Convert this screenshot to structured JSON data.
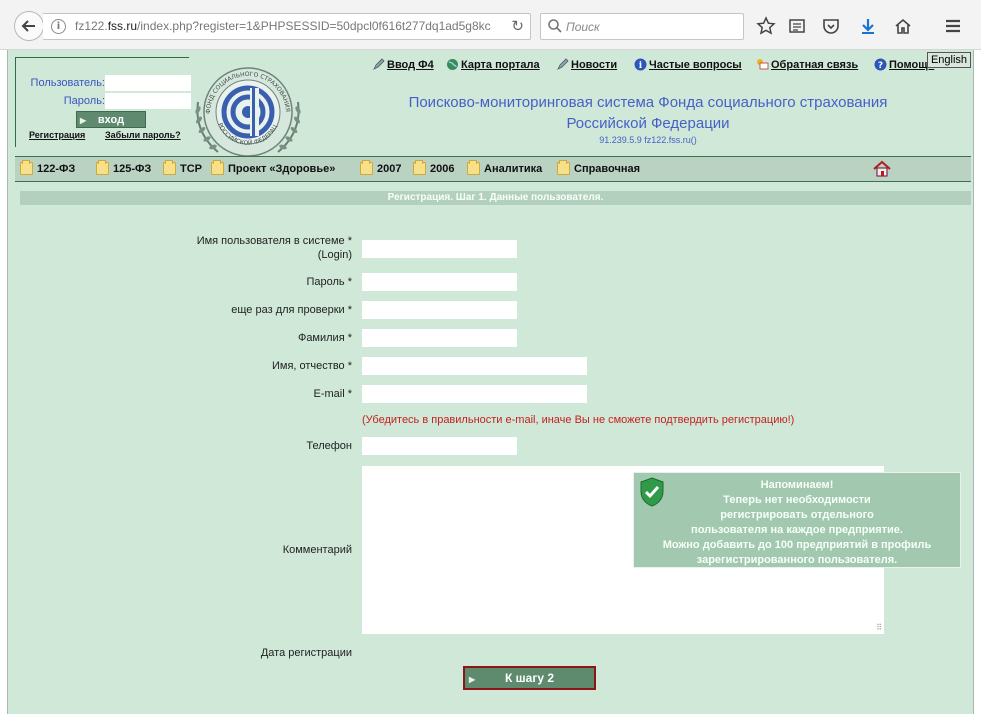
{
  "browser": {
    "url_prefix": "fz122.",
    "url_domain": "fss.ru",
    "url_rest": "/index.php?register=1&PHPSESSID=50dpcl0f616t277dq1ad5g8kc",
    "search_placeholder": "Поиск",
    "info_glyph": "i",
    "reload_glyph": "↻"
  },
  "login": {
    "user_label": "Пользователь:",
    "password_label": "Пароль:",
    "login_button": "вход",
    "register_link": "Регистрация",
    "forgot_link": "Забыли пароль?"
  },
  "logo": {
    "ring_text_top": "ФОНД СОЦИАЛЬНОГО СТРАХОВАНИЯ",
    "ring_text_bottom": "РОССИЙСКОЙ ФЕДЕРАЦИИ"
  },
  "top_links": [
    {
      "label": "Ввод Ф4",
      "icon": "pen-icon"
    },
    {
      "label": "Карта портала",
      "icon": "globe-icon"
    },
    {
      "label": "Новости",
      "icon": "pen-icon"
    },
    {
      "label": "Частые вопросы",
      "icon": "info-icon"
    },
    {
      "label": "Обратная связь",
      "icon": "mail-icon"
    },
    {
      "label": "Помощь",
      "icon": "help-icon"
    }
  ],
  "english": "English",
  "header": {
    "title_line1": "Поисково-мониторинговая система Фонда социального страхования",
    "title_line2": "Российской Федерации",
    "subtitle": "91.239.5.9  fz122.fss.ru()"
  },
  "menu": [
    {
      "label": "122-ФЗ"
    },
    {
      "label": "125-ФЗ"
    },
    {
      "label": "ТСР"
    },
    {
      "label": "Проект «Здоровье»"
    },
    {
      "label": "2007"
    },
    {
      "label": "2006"
    },
    {
      "label": "Аналитика"
    },
    {
      "label": "Справочная"
    }
  ],
  "section_title": "Регистрация. Шаг 1. Данные пользователя.",
  "form": {
    "login_label": "Имя пользователя в системе *",
    "login_label2": "(Login)",
    "password_label": "Пароль *",
    "password_repeat_label": "еще раз для проверки *",
    "surname_label": "Фамилия *",
    "name_label": "Имя, отчество *",
    "email_label": "E-mail *",
    "email_warning": "(Убедитесь в правильности e-mail, иначе Вы не сможете подтвердить регистрацию!)",
    "phone_label": "Телефон",
    "comment_label": "Комментарий",
    "date_label": "Дата регистрации",
    "next_button": "К шагу 2"
  },
  "reminder": {
    "line1": "Напоминаем!",
    "line2": "Теперь нет необходимости",
    "line3": "регистрировать отдельного",
    "line4": "пользователя на каждое предприятие.",
    "line5": "Можно добавить до 100 предприятий в профиль",
    "line6": "зарегистрированного пользователя."
  },
  "colors": {
    "page_bg": "#cfe8d8",
    "title_blue": "#4860c6",
    "warning_red": "#c62020",
    "button_green": "#5e8a6e"
  }
}
